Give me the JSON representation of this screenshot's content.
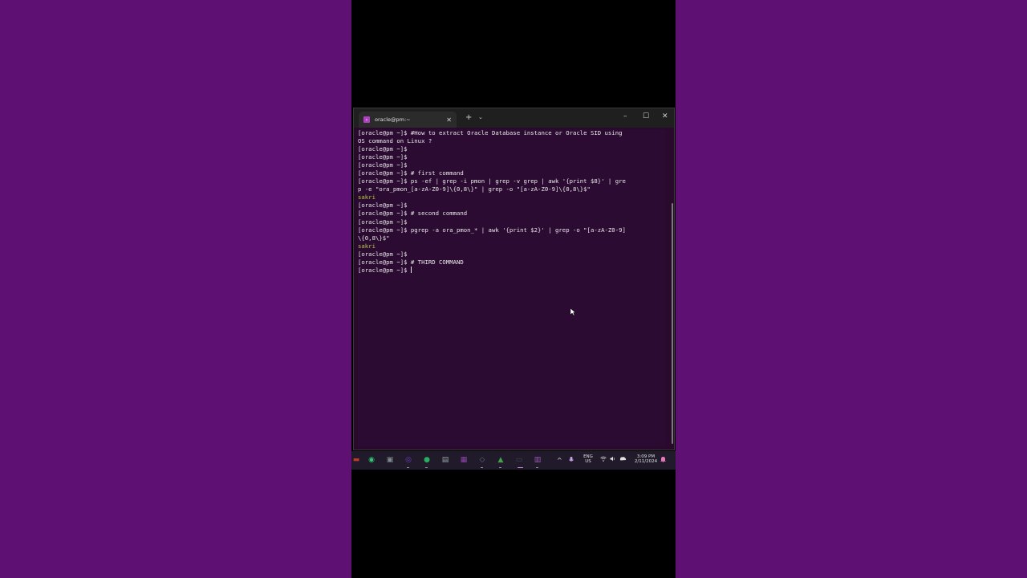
{
  "window": {
    "tab_title": "oracle@pm:~",
    "tab_icon": "terminal-icon",
    "controls": {
      "new_tab": "+",
      "tab_menu": "⌄",
      "minimize": "–",
      "maximize": "☐",
      "close": "✕"
    }
  },
  "terminal": {
    "lines": [
      {
        "text": "[oracle@pm ~]$ #How to extract Oracle Database instance or Oracle SID using",
        "type": "cmd"
      },
      {
        "text": "OS command on Linux ?",
        "type": "cmd"
      },
      {
        "text": "[oracle@pm ~]$",
        "type": "cmd"
      },
      {
        "text": "[oracle@pm ~]$",
        "type": "cmd"
      },
      {
        "text": "[oracle@pm ~]$",
        "type": "cmd"
      },
      {
        "text": "[oracle@pm ~]$ # first command",
        "type": "cmd"
      },
      {
        "text": "[oracle@pm ~]$ ps -ef | grep -i pmon | grep -v grep | awk '{print $8}' | gre",
        "type": "cmd"
      },
      {
        "text": "p -e \"ora_pmon_[a-zA-Z0-9]\\{0,8\\}\" | grep -o \"[a-zA-Z0-9]\\{0,8\\}$\"",
        "type": "cmd"
      },
      {
        "text": "sakri",
        "type": "out"
      },
      {
        "text": "[oracle@pm ~]$",
        "type": "cmd"
      },
      {
        "text": "[oracle@pm ~]$ # second command",
        "type": "cmd"
      },
      {
        "text": "[oracle@pm ~]$",
        "type": "cmd"
      },
      {
        "text": "[oracle@pm ~]$ pgrep -a ora_pmon_* | awk '{print $2}' | grep -o \"[a-zA-Z0-9]",
        "type": "cmd"
      },
      {
        "text": "\\{0,8\\}$\"",
        "type": "cmd"
      },
      {
        "text": "sakri",
        "type": "out"
      },
      {
        "text": "[oracle@pm ~]$",
        "type": "cmd"
      },
      {
        "text": "[oracle@pm ~]$ # THIRD COMMAND",
        "type": "cmd"
      },
      {
        "text": "[oracle@pm ~]$ ",
        "type": "cmd",
        "cursor": true
      }
    ]
  },
  "taskbar": {
    "icons": [
      {
        "name": "file-explorer-icon",
        "color": "#c0392b",
        "glyph": "▬"
      },
      {
        "name": "edge-icon",
        "color": "#2ecc71",
        "glyph": "◉"
      },
      {
        "name": "remote-desktop-icon",
        "color": "#7f8c8d",
        "glyph": "▣"
      },
      {
        "name": "whatsapp-icon",
        "color": "#6c3fc8",
        "glyph": "◎"
      },
      {
        "name": "chrome-icon",
        "color": "#27ae60",
        "glyph": "●"
      },
      {
        "name": "notepad-icon",
        "color": "#95a5a6",
        "glyph": "▤"
      },
      {
        "name": "apps-icon",
        "color": "#8e44ad",
        "glyph": "▦"
      },
      {
        "name": "virtualbox-icon",
        "color": "#5d6d7e",
        "glyph": "◇"
      },
      {
        "name": "vscode-icon",
        "color": "#3fa34d",
        "glyph": "▲"
      },
      {
        "name": "terminal-icon",
        "color": "#34495e",
        "glyph": "▭"
      },
      {
        "name": "onenote-icon",
        "color": "#9b59b6",
        "glyph": "▥"
      }
    ],
    "tray": {
      "chevron": "^",
      "mic": "🎙",
      "lang_top": "ENG",
      "lang_bottom": "US",
      "wifi": "◠",
      "volume": "🔈",
      "battery": "▭",
      "time": "3:09 PM",
      "date": "2/11/2024",
      "notification": "🔔"
    }
  }
}
